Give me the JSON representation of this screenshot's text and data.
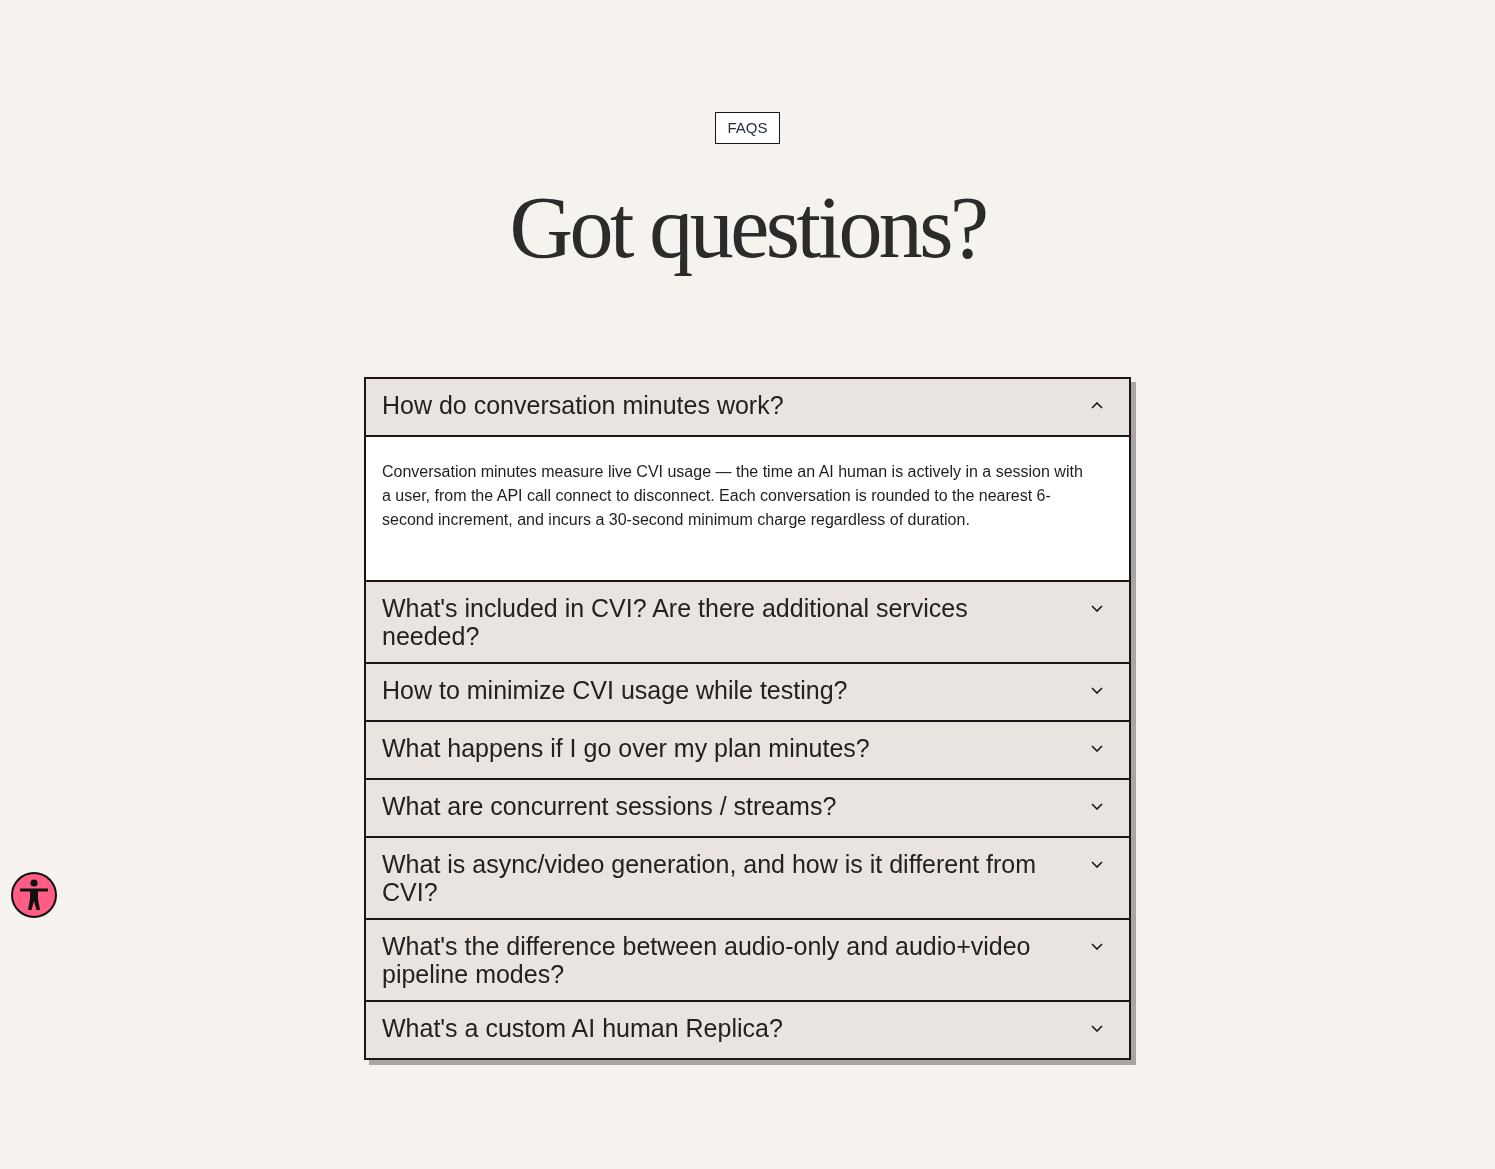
{
  "badge": "FAQS",
  "heading": "Got questions?",
  "faqs": [
    {
      "question": "How do conversation minutes work?",
      "expanded": true,
      "answer": "Conversation minutes measure live CVI usage — the time an AI human is actively in a session with a user, from the API call connect to disconnect. Each conversation is rounded to the nearest 6-second increment, and incurs a 30-second minimum charge regardless of duration."
    },
    {
      "question": "What's included in CVI? Are there additional services needed?",
      "expanded": false
    },
    {
      "question": "How to minimize CVI usage while testing?",
      "expanded": false
    },
    {
      "question": "What happens if I go over my plan minutes?",
      "expanded": false
    },
    {
      "question": "What are concurrent sessions / streams?",
      "expanded": false
    },
    {
      "question": "What is async/video generation, and how is it different from CVI?",
      "expanded": false
    },
    {
      "question": "What's the difference between audio-only and audio+video pipeline modes?",
      "expanded": false
    },
    {
      "question": "What's a custom AI human Replica?",
      "expanded": false
    }
  ]
}
